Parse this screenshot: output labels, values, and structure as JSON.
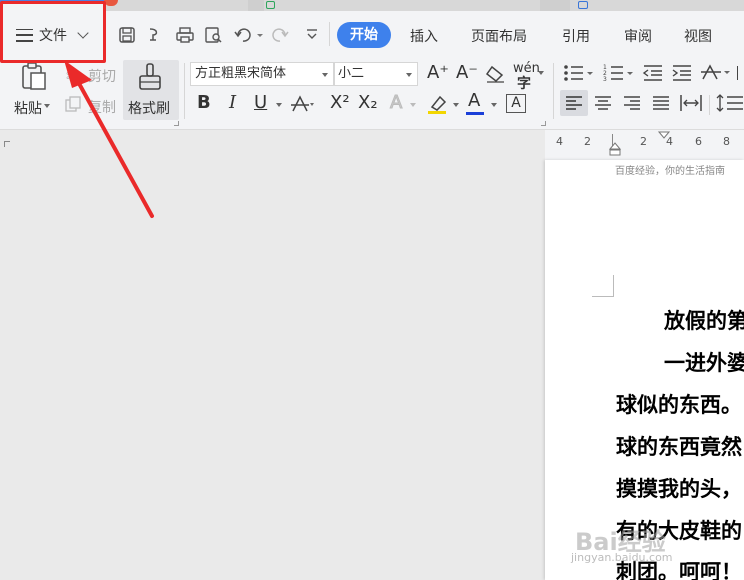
{
  "menu": {
    "file_label": "文件",
    "tabs": [
      "开始",
      "插入",
      "页面布局",
      "引用",
      "审阅",
      "视图"
    ]
  },
  "ribbon": {
    "paste_label": "粘贴",
    "cut_label": "剪切",
    "copy_label": "复制",
    "format_brush_label": "格式刷",
    "font_name": "方正粗黑宋简体",
    "font_size": "小二",
    "bold": "B",
    "italic": "I",
    "underline": "U",
    "pinyin": "wén",
    "superscript": "X²",
    "subscript": "X₂",
    "grow_font": "A⁺",
    "shrink_font": "A⁻",
    "text_effect": "A",
    "font_color_letter": "A",
    "char_border_letter": "A"
  },
  "ruler": {
    "numbers": [
      "4",
      "2",
      "2",
      "4",
      "6",
      "8"
    ]
  },
  "document": {
    "header": "百度经验，你的生活指南",
    "lines": [
      "放假的第",
      "一进外婆",
      "球似的东西。",
      "球的东西竟然",
      "摸摸我的头，",
      "有的大皮鞋的",
      "刺团。呵呵！"
    ]
  },
  "watermark": {
    "brand": "Bai经验",
    "url": "jingyan.baidu.com"
  },
  "colors": {
    "accent": "#3e81ec",
    "annotation": "#ea2a2a",
    "font_color_underline": "#1a3fd8",
    "highlight_underline": "#f2d600"
  }
}
